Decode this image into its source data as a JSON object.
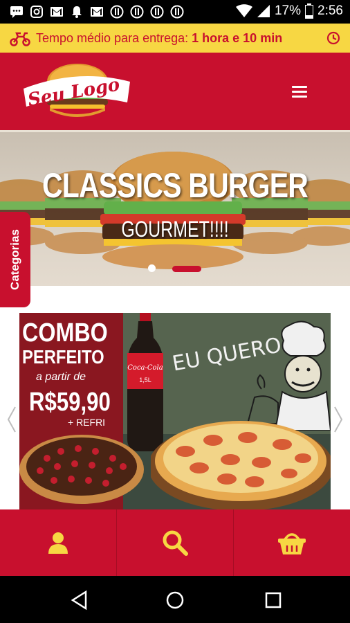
{
  "status_bar": {
    "battery": "17%",
    "time": "2:56",
    "icons": [
      "message-icon",
      "instagram-icon",
      "gmail-icon",
      "notification-bell-icon",
      "gmail-icon",
      "whatsapp-icon",
      "whatsapp-icon",
      "whatsapp-icon",
      "whatsapp-icon",
      "wifi-icon",
      "signal-icon",
      "battery-icon"
    ]
  },
  "delivery_banner": {
    "label": "Tempo médio para entrega: ",
    "value": "1 hora e 10 min",
    "icons": [
      "motorcycle-icon",
      "clock-icon"
    ]
  },
  "header": {
    "logo_text": "Seu Logo",
    "menu_icon": "hamburger-menu-icon"
  },
  "hero": {
    "title": "CLASSICS BURGER",
    "subtitle": "GOURMET!!!!",
    "slide_count": 2,
    "active_slide": 1
  },
  "side_tab": {
    "label": "Categorias"
  },
  "promo": {
    "line1": "COMBO",
    "line2": "PERFEITO",
    "from_label": "a partir de",
    "price": "R$59,90",
    "extra": "+ REFRI",
    "callout": "EU QUERO !!",
    "bottle_label": "Coca-Cola",
    "bottle_size": "1,5L"
  },
  "bottom_nav": {
    "items": [
      {
        "icon": "user-icon"
      },
      {
        "icon": "search-icon"
      },
      {
        "icon": "shopping-basket-icon"
      }
    ]
  },
  "colors": {
    "brand_red": "#c8102e",
    "brand_yellow": "#f7d743"
  }
}
